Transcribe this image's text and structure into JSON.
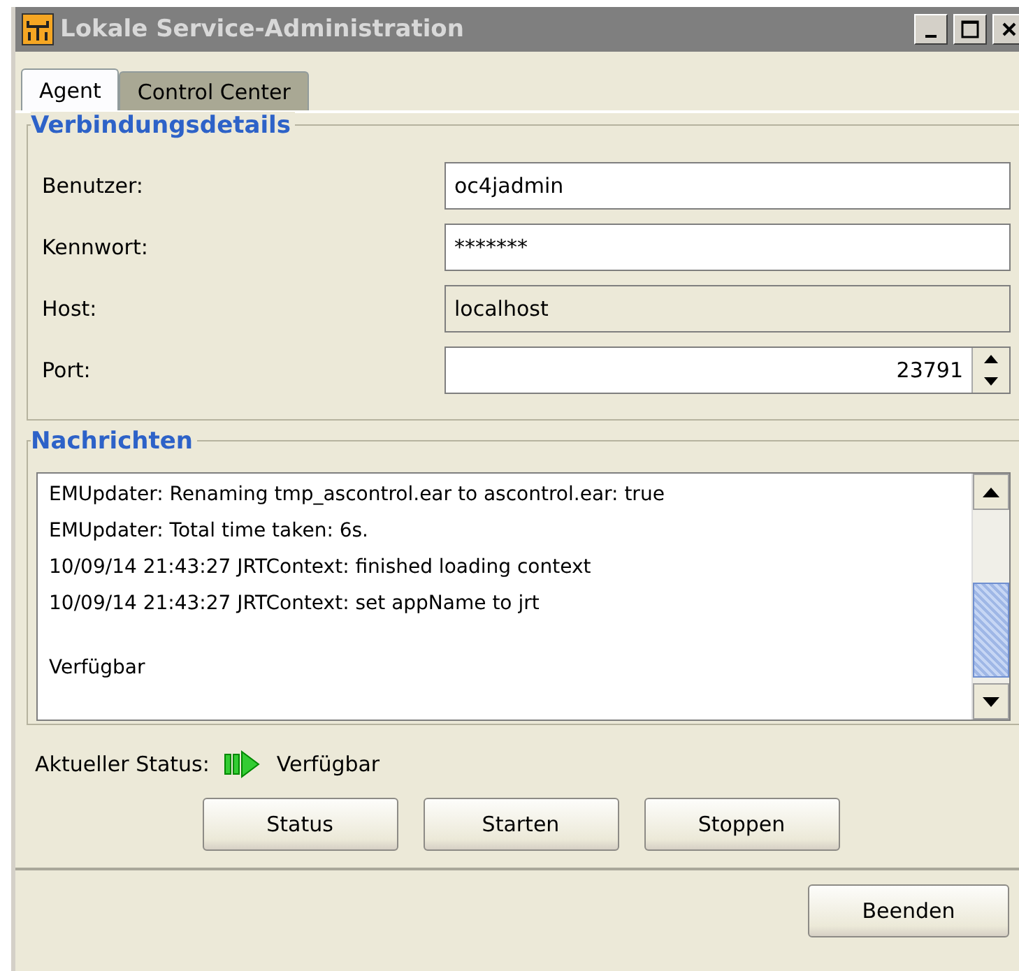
{
  "window": {
    "title": "Lokale Service-Administration"
  },
  "tabs": [
    {
      "label": "Agent",
      "selected": true
    },
    {
      "label": "Control Center",
      "selected": false
    }
  ],
  "connection": {
    "title": "Verbindungsdetails",
    "fields": [
      {
        "label": "Benutzer:",
        "value": "oc4jadmin",
        "editable": true,
        "kind": "text"
      },
      {
        "label": "Kennwort:",
        "value": "*******",
        "editable": true,
        "kind": "text"
      },
      {
        "label": "Host:",
        "value": "localhost",
        "editable": false,
        "kind": "text"
      },
      {
        "label": "Port:",
        "value": "23791",
        "editable": true,
        "kind": "spinner"
      }
    ]
  },
  "messages": {
    "title": "Nachrichten",
    "lines": [
      {
        "text": "EMUpdater: Renaming tmp_ascontrol.ear to ascontrol.ear: true",
        "gap_before": false
      },
      {
        "text": "EMUpdater: Total time taken: 6s.",
        "gap_before": false
      },
      {
        "text": "10/09/14 21:43:27 JRTContext: finished loading context",
        "gap_before": false
      },
      {
        "text": "10/09/14 21:43:27 JRTContext: set appName to jrt",
        "gap_before": false
      },
      {
        "text": "Verfügbar",
        "gap_before": true
      }
    ]
  },
  "status": {
    "label": "Aktueller Status:",
    "value": "Verfügbar"
  },
  "actions": [
    "Status",
    "Starten",
    "Stoppen"
  ],
  "footer_button": "Beenden"
}
